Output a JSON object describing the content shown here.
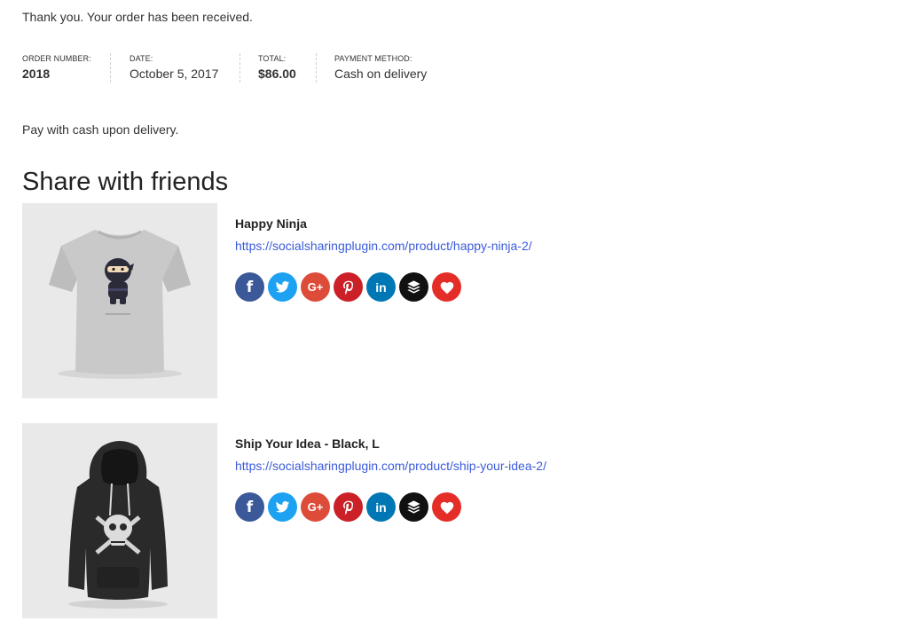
{
  "order": {
    "thank_you": "Thank you. Your order has been received.",
    "number_label": "Order number:",
    "number_value": "2018",
    "date_label": "Date:",
    "date_value": "October 5, 2017",
    "total_label": "Total:",
    "total_value": "$86.00",
    "payment_label": "Payment method:",
    "payment_value": "Cash on delivery",
    "payment_note": "Pay with cash upon delivery."
  },
  "share": {
    "title": "Share with friends",
    "buttons": [
      {
        "icon": "facebook-icon",
        "glyph": "f",
        "color": "#3b5998"
      },
      {
        "icon": "twitter-icon",
        "glyph": "t",
        "color": "#1da1f2"
      },
      {
        "icon": "google-plus-icon",
        "glyph": "G+",
        "color": "#dd4b39"
      },
      {
        "icon": "pinterest-icon",
        "glyph": "p",
        "color": "#cb2027"
      },
      {
        "icon": "linkedin-icon",
        "glyph": "in",
        "color": "#0077b5"
      },
      {
        "icon": "buffer-icon",
        "glyph": "",
        "color": "#111111"
      },
      {
        "icon": "heart-icon",
        "glyph": "",
        "color": "#e52d27"
      }
    ]
  },
  "products": [
    {
      "name": "Happy Ninja",
      "url": "https://socialsharingplugin.com/product/happy-ninja-2/",
      "image_icon": "ninja-tshirt-icon"
    },
    {
      "name": "Ship Your Idea - Black, L",
      "url": "https://socialsharingplugin.com/product/ship-your-idea-2/",
      "image_icon": "black-hoodie-icon"
    }
  ]
}
